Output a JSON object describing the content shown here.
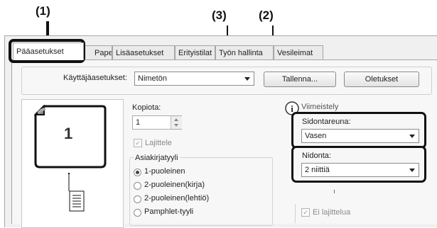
{
  "callouts": [
    "(1)",
    "(3)",
    "(2)"
  ],
  "tabs": [
    {
      "label": "Pääasetukset"
    },
    {
      "label": "Paperi"
    },
    {
      "label": "Lisäasetukset"
    },
    {
      "label": "Erityistilat"
    },
    {
      "label": "Työn hallinta"
    },
    {
      "label": "Vesileimat"
    }
  ],
  "user_settings": {
    "label": "Käyttäjäasetukset:",
    "value": "Nimetön",
    "save_button": "Tallenna...",
    "defaults_button": "Oletukset"
  },
  "preview": {
    "page_number": "1"
  },
  "copies": {
    "label": "Kopiota:",
    "value": "1"
  },
  "collate": {
    "label": "Lajittele"
  },
  "document_style": {
    "label": "Asiakirjatyyli",
    "options": [
      "1-puoleinen",
      "2-puoleinen(kirja)",
      "2-puoleinen(lehtiö)",
      "Pamphlet-tyyli"
    ],
    "selected": "1-puoleinen"
  },
  "info_label": "Viimeistely",
  "binding_edge": {
    "label": "Sidontareuna:",
    "value": "Vasen"
  },
  "staple": {
    "label": "Nidonta:",
    "value": "2 niittiä"
  },
  "offset": {
    "label": "Ei lajittelua"
  },
  "colors": {
    "highlight": "#111111",
    "panel": "#f7f7f7"
  }
}
